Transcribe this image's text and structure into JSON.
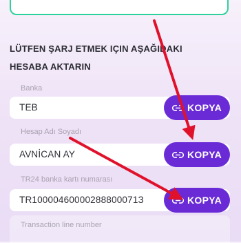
{
  "instructions": {
    "heading": "LÜTFEN ŞARJ ETMEK IÇIN AŞAĞIDAKI HESABA AKTARIN"
  },
  "fields": {
    "bank": {
      "label": "Banka",
      "value": "TEB",
      "button_label": "KOPYA"
    },
    "account_holder": {
      "label": "Hesap Adı Soyadı",
      "value": "AVNİCAN AY",
      "button_label": "KOPYA"
    },
    "card_number": {
      "label": "TR24 banka kartı numarası",
      "value": "TR10000460000288800071З",
      "button_label": "KOPYA"
    },
    "transaction_line": {
      "label": "Transaction line number"
    }
  },
  "colors": {
    "button_bg": "#6a2bd6",
    "arrow": "#e0112b",
    "top_box_border": "#2fd19a"
  }
}
